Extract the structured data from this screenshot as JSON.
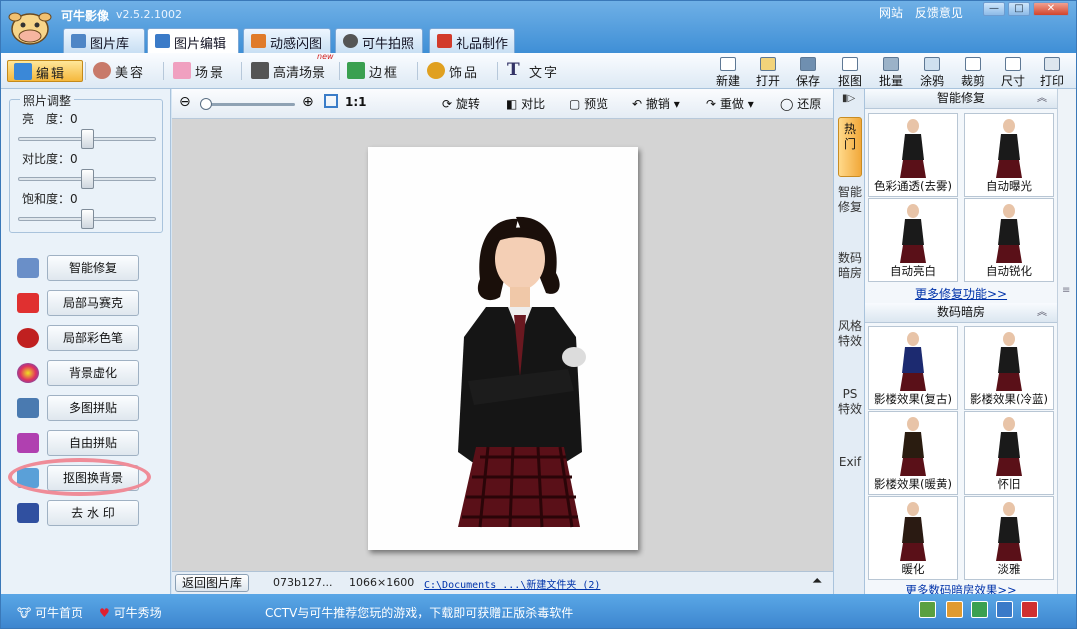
{
  "app": {
    "title": "可牛影像",
    "version": "v2.5.2.1002",
    "links": [
      "网站",
      "反馈意见"
    ]
  },
  "window_controls": [
    "—",
    "□",
    "✕"
  ],
  "tabs": [
    {
      "label": "图片库",
      "active": false,
      "icon": "gallery-icon",
      "color": "#4f86c6"
    },
    {
      "label": "图片编辑",
      "active": true,
      "icon": "edit-photo-icon",
      "color": "#3b7bc8"
    },
    {
      "label": "动感闪图",
      "active": false,
      "icon": "animation-icon",
      "color": "#e07b2a"
    },
    {
      "label": "可牛拍照",
      "active": false,
      "icon": "camera-icon",
      "color": "#555555"
    },
    {
      "label": "礼品制作",
      "active": false,
      "icon": "gift-icon",
      "color": "#d23b2b"
    }
  ],
  "toolbar": {
    "tools": [
      {
        "label": "编辑",
        "active": true,
        "icon": "edit-icon",
        "color": "#3a88d8"
      },
      {
        "label": "美容",
        "active": false,
        "icon": "beauty-icon",
        "color": "#c87a6a"
      },
      {
        "label": "场景",
        "active": false,
        "icon": "scene-icon",
        "color": "#f0a0c0"
      },
      {
        "label": "高清场景",
        "active": false,
        "icon": "hd-scene-icon",
        "color": "#555555",
        "badge": "new"
      },
      {
        "label": "边框",
        "active": false,
        "icon": "frame-icon",
        "color": "#3aa050"
      },
      {
        "label": "饰品",
        "active": false,
        "icon": "decoration-icon",
        "color": "#e0a020"
      },
      {
        "label": "文字",
        "active": false,
        "icon": "text-icon",
        "color": "#333366"
      }
    ],
    "actions": [
      {
        "label": "新建",
        "icon": "new-file-icon"
      },
      {
        "label": "打开",
        "icon": "open-folder-icon"
      },
      {
        "label": "保存",
        "icon": "save-icon"
      },
      {
        "label": "抠图",
        "icon": "cutout-icon"
      },
      {
        "label": "批量",
        "icon": "batch-icon"
      },
      {
        "label": "涂鸦",
        "icon": "doodle-icon"
      },
      {
        "label": "裁剪",
        "icon": "crop-icon"
      },
      {
        "label": "尺寸",
        "icon": "resize-icon"
      },
      {
        "label": "打印",
        "icon": "print-icon"
      }
    ]
  },
  "adjust": {
    "title": "照片调整",
    "brightness": {
      "label": "亮　度：",
      "value": "0",
      "level": 0.5
    },
    "contrast": {
      "label": "对比度：",
      "value": "0",
      "level": 0.5
    },
    "saturation": {
      "label": "饱和度：",
      "value": "0",
      "level": 0.5
    }
  },
  "functions": [
    {
      "label": "智能修复",
      "icon": "smart-fix-icon",
      "color": "#6a8fc8"
    },
    {
      "label": "局部马赛克",
      "icon": "mosaic-icon",
      "color": "#e03030"
    },
    {
      "label": "局部彩色笔",
      "icon": "color-pen-icon",
      "color": "#c02020"
    },
    {
      "label": "背景虚化",
      "icon": "blur-background-icon",
      "color": "#8a50c0"
    },
    {
      "label": "多图拼贴",
      "icon": "multi-collage-icon",
      "color": "#4a7ab0"
    },
    {
      "label": "自由拼贴",
      "icon": "free-collage-icon",
      "color": "#b040b0"
    },
    {
      "label": "抠图换背景",
      "icon": "cutout-background-icon",
      "color": "#5aa0d8"
    },
    {
      "label": "去 水 印",
      "icon": "remove-watermark-icon",
      "color": "#3050a0"
    }
  ],
  "canvas_toolbar": {
    "zoom_level": 0.0,
    "actual_size": "1:1",
    "rotate": "旋转",
    "compare": "对比",
    "preview": "预览",
    "undo": "撤销",
    "redo": "重做",
    "restore": "还原"
  },
  "status": {
    "back": "返回图片库",
    "filename": "073b127...",
    "dimensions": "1066×1600",
    "path": "C:\\Documents ...\\新建文件夹 (2)"
  },
  "side_tabs": [
    {
      "label": "热门",
      "active": true
    },
    {
      "label": "智能修复",
      "active": false
    },
    {
      "label": "数码暗房",
      "active": false
    },
    {
      "label": "风格特效",
      "active": false
    },
    {
      "label": "PS特效",
      "active": false
    },
    {
      "label": "Exif",
      "active": false
    }
  ],
  "effects_panel": {
    "smart_fix": {
      "title": "智能修复",
      "items": [
        "色彩通透(去雾)",
        "自动曝光",
        "自动亮白",
        "自动锐化"
      ],
      "more": "更多修复功能>>"
    },
    "darkroom": {
      "title": "数码暗房",
      "items": [
        "影楼效果(复古)",
        "影楼效果(冷蓝)",
        "影楼效果(暖黄)",
        "怀旧",
        "暖化",
        "淡雅"
      ],
      "more": "更多数码暗房效果>>"
    }
  },
  "bottom": {
    "home": "可牛首页",
    "show": "可牛秀场",
    "marquee": "CCTV与可牛推荐您玩的游戏，下载即可获赠正版杀毒软件"
  },
  "colors": {
    "accent": "#3f8fd6",
    "active_tab": "#f5b83d",
    "highlight_ring": "#ef8c98",
    "link": "#0033aa"
  }
}
